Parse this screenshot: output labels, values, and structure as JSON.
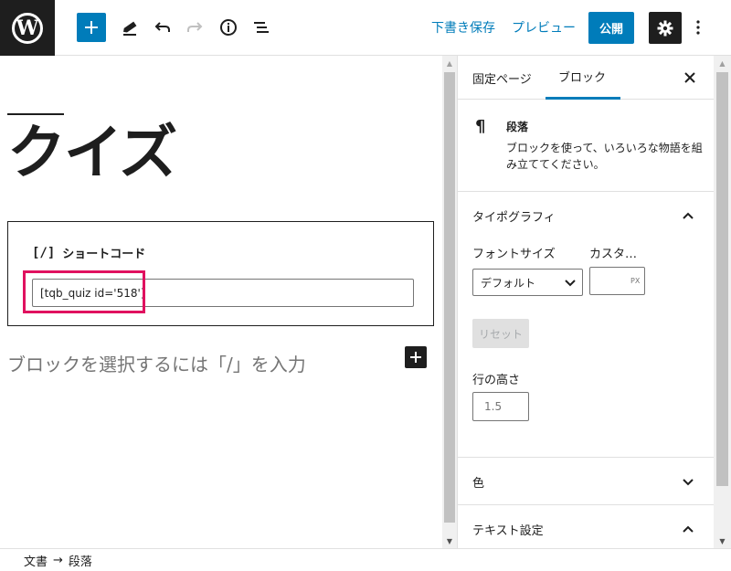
{
  "toolbar": {
    "logo": "W",
    "add_icon": "plus-icon",
    "tools_icon": "pencil-icon",
    "undo_icon": "undo-icon",
    "redo_icon": "redo-icon",
    "details_icon": "info-icon",
    "list_view_icon": "list-view-icon",
    "save_draft_label": "下書き保存",
    "preview_label": "プレビュー",
    "publish_label": "公開",
    "settings_icon": "gear-icon",
    "more_icon": "more-vertical-icon"
  },
  "editor": {
    "post_title": "クイズ",
    "shortcode_block": {
      "icon_text": "[/]",
      "label": "ショートコード",
      "value": "[tqb_quiz id='518']"
    },
    "appender_placeholder": "ブロックを選択するには「/」を入力"
  },
  "sidebar": {
    "tabs": [
      {
        "label": "固定ページ",
        "active": false
      },
      {
        "label": "ブロック",
        "active": true
      }
    ],
    "close_icon": "close-icon",
    "block_card": {
      "icon": "¶",
      "title": "段落",
      "description": "ブロックを使って、いろいろな物語を組み立ててください。"
    },
    "typography": {
      "title": "タイポグラフィ",
      "font_size_label": "フォントサイズ",
      "font_size_value": "デフォルト",
      "custom_label": "カスタ…",
      "custom_unit": "PX",
      "reset_label": "リセット",
      "line_height_label": "行の高さ",
      "line_height_placeholder": "1.5"
    },
    "color_panel_title": "色",
    "text_settings_title": "テキスト設定"
  },
  "breadcrumb": {
    "items": [
      "文書",
      "段落"
    ],
    "separator": "→"
  },
  "colors": {
    "accent": "#007cba",
    "dark": "#1e1e1e",
    "highlight": "#e0115f"
  }
}
